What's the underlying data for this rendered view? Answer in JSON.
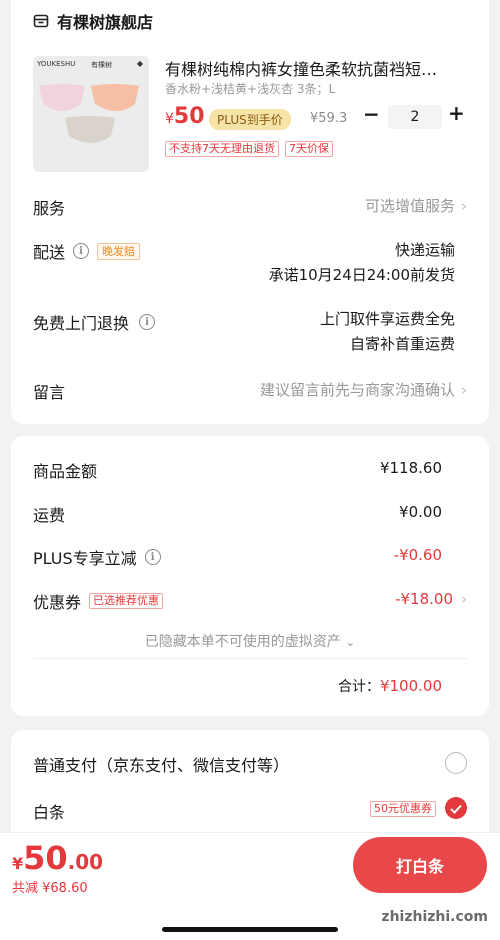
{
  "store": {
    "name": "有棵树旗舰店",
    "icon": "store-icon"
  },
  "product": {
    "brand_text": "YOUKESHU",
    "brand_cn": "有棵树",
    "title": "有棵树纯棉内裤女撞色柔软抗菌裆短…",
    "spec": "香水粉+浅桔黄+浅灰杏 3条；L",
    "price_symbol": "¥",
    "price": "50",
    "plus_label": "PLUS到手价",
    "original_price": "¥59.3",
    "quantity": "2",
    "minus_label": "−",
    "plus_btn_label": "+",
    "tags": [
      "不支持7天无理由退货",
      "7天价保"
    ],
    "swatch_colors": [
      "#f1d3dc",
      "#f6bfa3",
      "#d9d3cc"
    ]
  },
  "service": {
    "label": "服务",
    "value": "可选增值服务"
  },
  "delivery": {
    "label": "配送",
    "badge": "晚发赔",
    "method": "快递运输",
    "promise": "承诺10月24日24:00前发货"
  },
  "free_return": {
    "label": "免费上门退换",
    "line1": "上门取件享运费全免",
    "line2": "自寄补首重运费"
  },
  "message": {
    "label": "留言",
    "placeholder": "建议留言前先与商家沟通确认"
  },
  "summary": {
    "goods_label": "商品金额",
    "goods_value": "¥118.60",
    "shipping_label": "运费",
    "shipping_value": "¥0.00",
    "plus_label": "PLUS专享立减",
    "plus_value": "-¥0.60",
    "coupon_label": "优惠券",
    "coupon_badge": "已选推荐优惠",
    "coupon_value": "-¥18.00",
    "hidden_assets": "已隐藏本单不可使用的虚拟资产",
    "total_label": "合计：",
    "total_value": "¥100.00"
  },
  "payment": {
    "normal_label": "普通支付（京东支付、微信支付等）",
    "baitiao_label": "白条",
    "baitiao_badge": "50元优惠券"
  },
  "bottom": {
    "price_symbol": "¥",
    "price_int": "50",
    "price_dec": ".00",
    "saved": "共减 ¥68.60",
    "pay_button": "打白条"
  },
  "watermark": "zhizhizhi.com",
  "colors": {
    "accent": "#e4393c",
    "plus_gold": "#f6e3a8",
    "background": "#f2f2f2"
  }
}
